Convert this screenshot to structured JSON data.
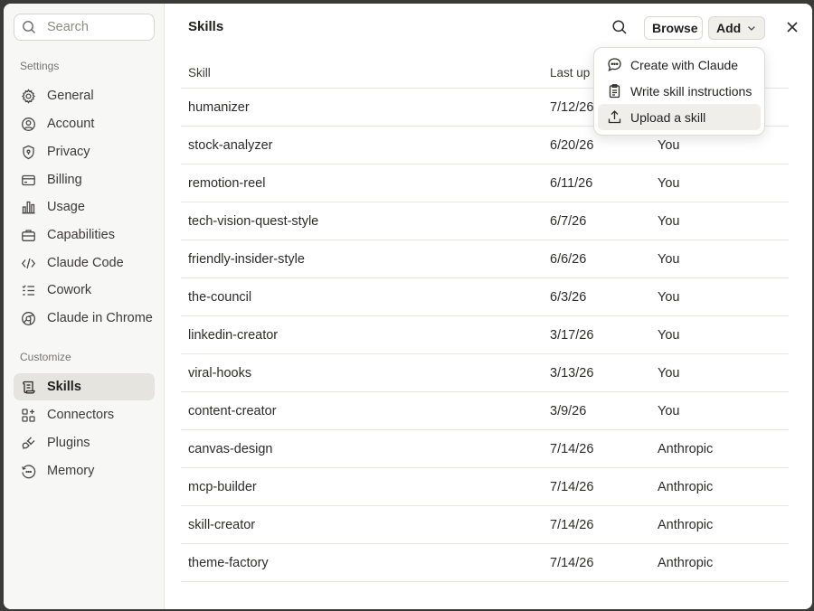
{
  "sidebar": {
    "search_placeholder": "Search",
    "settings_label": "Settings",
    "customize_label": "Customize",
    "settings_items": [
      {
        "label": "General",
        "icon": "gear-icon"
      },
      {
        "label": "Account",
        "icon": "user-circle-icon"
      },
      {
        "label": "Privacy",
        "icon": "shield-icon"
      },
      {
        "label": "Billing",
        "icon": "credit-card-icon"
      },
      {
        "label": "Usage",
        "icon": "bar-chart-icon"
      },
      {
        "label": "Capabilities",
        "icon": "briefcase-icon"
      },
      {
        "label": "Claude Code",
        "icon": "code-icon"
      },
      {
        "label": "Cowork",
        "icon": "checklist-icon"
      },
      {
        "label": "Claude in Chrome",
        "icon": "globe-icon"
      }
    ],
    "customize_items": [
      {
        "label": "Skills",
        "icon": "scroll-icon",
        "active": true
      },
      {
        "label": "Connectors",
        "icon": "grid-plus-icon"
      },
      {
        "label": "Plugins",
        "icon": "plug-icon"
      },
      {
        "label": "Memory",
        "icon": "history-icon"
      }
    ]
  },
  "header": {
    "title": "Skills",
    "browse_label": "Browse",
    "add_label": "Add"
  },
  "table": {
    "columns": [
      "Skill",
      "Last up"
    ],
    "rows": [
      {
        "skill": "humanizer",
        "date": "7/12/26",
        "by": ""
      },
      {
        "skill": "stock-analyzer",
        "date": "6/20/26",
        "by": "You"
      },
      {
        "skill": "remotion-reel",
        "date": "6/11/26",
        "by": "You"
      },
      {
        "skill": "tech-vision-quest-style",
        "date": "6/7/26",
        "by": "You"
      },
      {
        "skill": "friendly-insider-style",
        "date": "6/6/26",
        "by": "You"
      },
      {
        "skill": "the-council",
        "date": "6/3/26",
        "by": "You"
      },
      {
        "skill": "linkedin-creator",
        "date": "3/17/26",
        "by": "You"
      },
      {
        "skill": "viral-hooks",
        "date": "3/13/26",
        "by": "You"
      },
      {
        "skill": "content-creator",
        "date": "3/9/26",
        "by": "You"
      },
      {
        "skill": "canvas-design",
        "date": "7/14/26",
        "by": "Anthropic"
      },
      {
        "skill": "mcp-builder",
        "date": "7/14/26",
        "by": "Anthropic"
      },
      {
        "skill": "skill-creator",
        "date": "7/14/26",
        "by": "Anthropic"
      },
      {
        "skill": "theme-factory",
        "date": "7/14/26",
        "by": "Anthropic"
      }
    ]
  },
  "add_menu": {
    "items": [
      {
        "label": "Create with Claude",
        "icon": "chat-bubble-icon"
      },
      {
        "label": "Write skill instructions",
        "icon": "clipboard-icon"
      },
      {
        "label": "Upload a skill",
        "icon": "upload-icon",
        "hovered": true
      }
    ]
  }
}
